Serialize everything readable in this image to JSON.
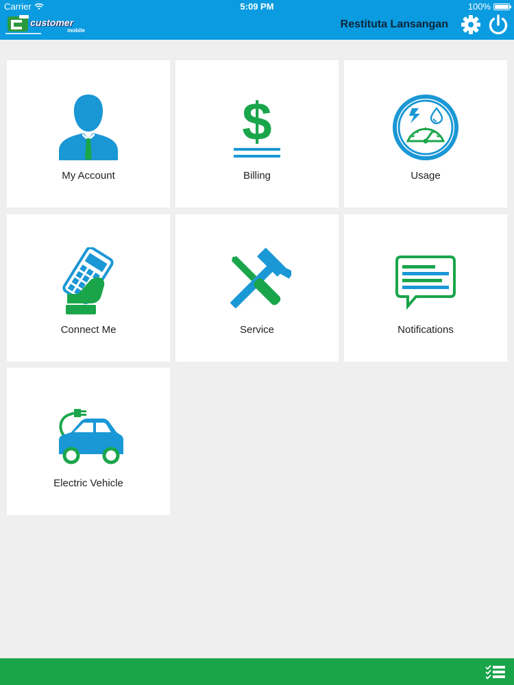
{
  "status_bar": {
    "carrier": "Carrier",
    "time": "5:09 PM",
    "battery": "100%",
    "battery_level": 1.0
  },
  "header": {
    "logo_icon": "company-logo-icon",
    "logo_text": "customer",
    "logo_sub": "mobile",
    "user_name": "Restituta Lansangan",
    "settings_icon": "gear-icon",
    "power_icon": "power-icon"
  },
  "tiles": [
    {
      "label": "My Account",
      "icon": "person-icon"
    },
    {
      "label": "Billing",
      "icon": "dollar-icon"
    },
    {
      "label": "Usage",
      "icon": "gauge-icon"
    },
    {
      "label": "Connect Me",
      "icon": "phone-keypad-icon"
    },
    {
      "label": "Service",
      "icon": "tools-icon"
    },
    {
      "label": "Notifications",
      "icon": "message-icon"
    },
    {
      "label": "Electric Vehicle",
      "icon": "electric-car-icon"
    }
  ],
  "bottom_bar": {
    "checklist_icon": "checklist-icon"
  },
  "colors": {
    "header_bg": "#0a9be0",
    "page_bg": "#efefef",
    "icon_blue": "#1a97d5",
    "icon_green": "#1aa54b",
    "footer_bg": "#1aa54b"
  }
}
